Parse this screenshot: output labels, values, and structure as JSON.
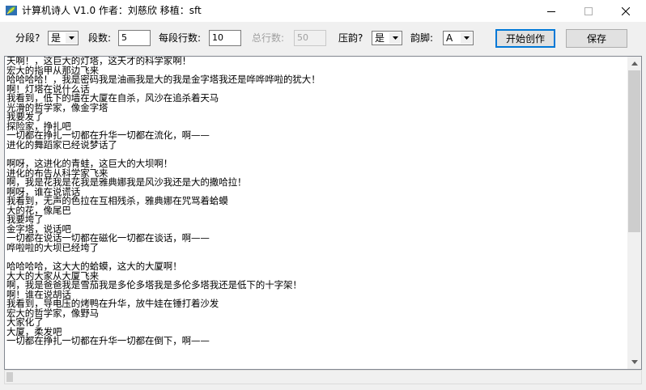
{
  "window": {
    "title": "计算机诗人 V1.0 作者：刘慈欣 移植：sft",
    "icons": {
      "app": "leaf-app-icon",
      "minimize": "minimize-icon",
      "maximize": "maximize-icon",
      "close": "close-icon"
    }
  },
  "toolbar": {
    "segment_label": "分段?",
    "segment_value": "是",
    "sections_label": "段数:",
    "sections_value": "5",
    "lines_per_section_label": "每段行数:",
    "lines_per_section_value": "10",
    "total_lines_label": "总行数:",
    "total_lines_value": "50",
    "rhyme_label": "压韵?",
    "rhyme_value": "是",
    "rhyme_foot_label": "韵脚:",
    "rhyme_foot_value": "A",
    "start_button": "开始创作",
    "save_button": "保存"
  },
  "poem": {
    "lines": [
      "天啊！，这巨大的灯塔，这天才的科学家啊！",
      "宏大的指甲从那边飞来",
      "哈哈哈哈！，我是密码我是油画我是大的我是金字塔我还是哗哗哗啦的犹大！",
      "啊！灯塔在说什么话",
      "我看到，低下的墙在大厦在自杀，风沙在追杀着天马",
      "光滑的哲学家，像金字塔",
      "我要发了",
      "探险家，挣扎吧",
      "一切都在挣扎一切都在升华一切都在流化，啊——",
      "进化的舞蹈家已经说梦话了",
      "",
      "啊呀，这进化的青蛙，这巨大的大坝啊！",
      "进化的布告从科学家飞来",
      "啊，我是花我是花我是雅典娜我是风沙我还是大的撒哈拉！",
      "啊呀，谁在说谎话",
      "我看到，无声的色拉在互相残杀，雅典娜在咒骂着蛤蟆",
      "大的花，像尾巴",
      "我要垮了",
      "金字塔，说话吧",
      "一切都在说话一切都在磁化一切都在谈话，啊——",
      "哗啦啦的大坝已经垮了",
      "",
      "哈哈哈哈，这大大的蛤蟆，这大的大厦啊！",
      "大大的大家从大厦飞来",
      "啊，我是爸爸我是雪茄我是多伦多塔我是多伦多塔我还是低下的十字架！",
      "啊！谁在说胡话",
      "我看到，导电压的烤鸭在升华，放牛娃在锤打着沙发",
      "宏大的哲学家，像野马",
      "大家化了",
      "大厦，柔发吧",
      "一切都在挣扎一切都在升华一切都在倒下，啊——"
    ]
  }
}
